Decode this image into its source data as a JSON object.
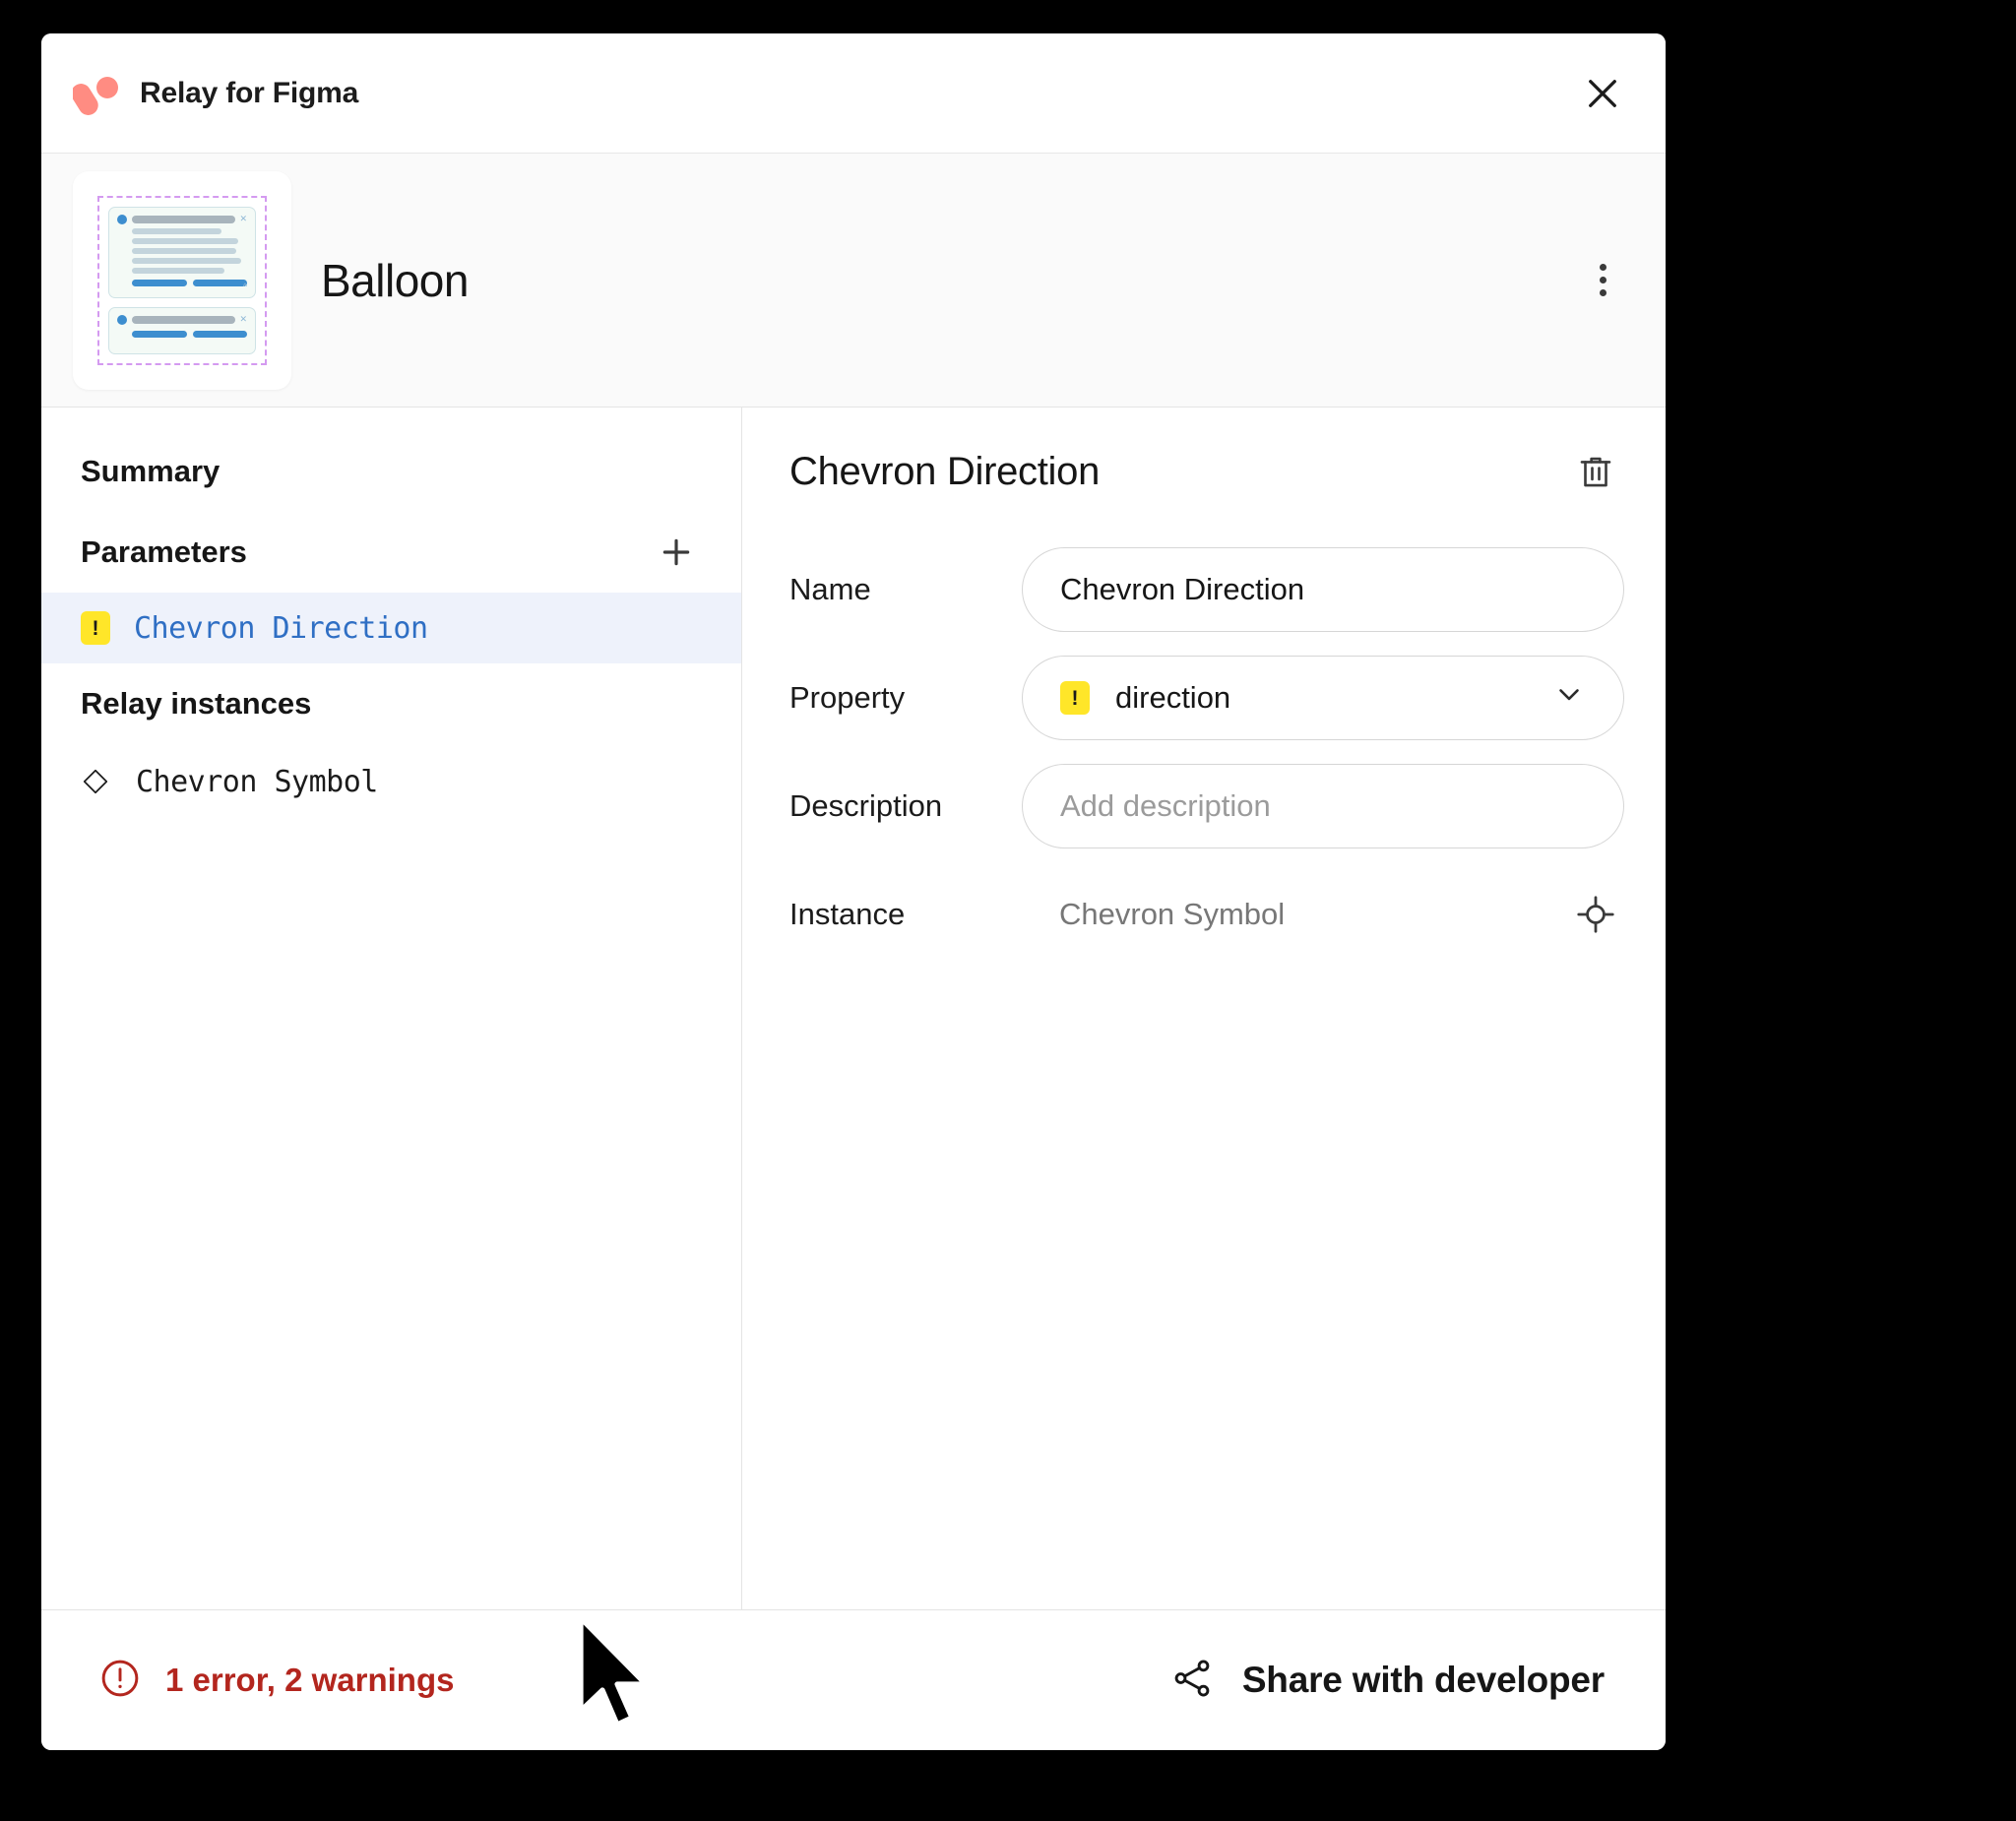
{
  "titlebar": {
    "app_name": "Relay for Figma",
    "logo_color": "#ff8c82",
    "close_icon": "close-icon"
  },
  "file_header": {
    "file_name": "Balloon",
    "thumbnail_alt": "Balloon component thumbnail",
    "menu_icon": "kebab-menu-icon"
  },
  "sidebar": {
    "summary_label": "Summary",
    "parameters_label": "Parameters",
    "add_parameter_icon": "plus-icon",
    "parameters": [
      {
        "label": "Chevron Direction",
        "badge": "!",
        "badge_color": "#ffe629",
        "selected": true
      }
    ],
    "relay_instances_label": "Relay instances",
    "instances": [
      {
        "label": "Chevron Symbol",
        "icon": "diamond-icon"
      }
    ]
  },
  "detail": {
    "title": "Chevron Direction",
    "delete_icon": "trash-icon",
    "fields": {
      "name_label": "Name",
      "name_value": "Chevron Direction",
      "property_label": "Property",
      "property_value": "direction",
      "property_badge": "!",
      "property_dropdown_icon": "chevron-down-icon",
      "description_label": "Description",
      "description_value": "",
      "description_placeholder": "Add description",
      "instance_label": "Instance",
      "instance_value": "Chevron Symbol",
      "instance_locate_icon": "target-icon"
    }
  },
  "footer": {
    "status_icon": "error-circle-icon",
    "status_text": "1 error, 2 warnings",
    "status_color": "#b3261e",
    "share_icon": "share-icon",
    "share_label": "Share with developer"
  }
}
